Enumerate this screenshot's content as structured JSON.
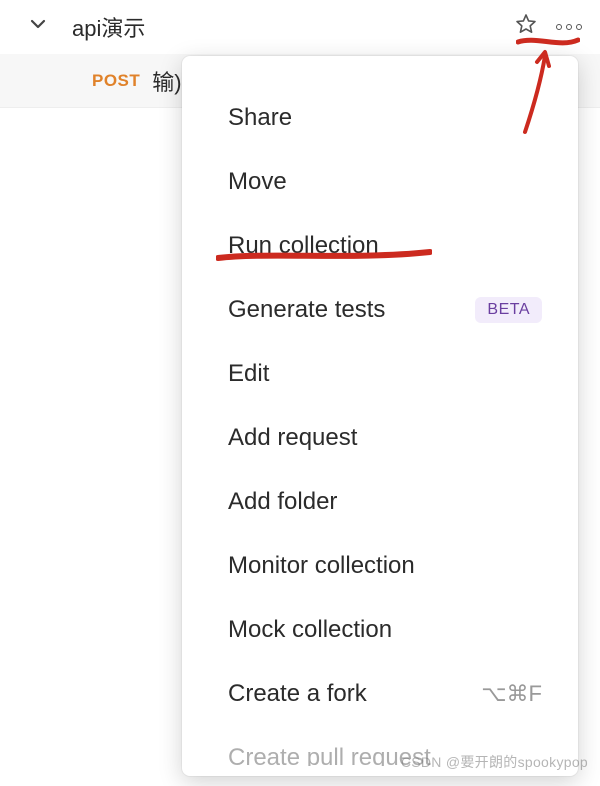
{
  "header": {
    "title": "api演示"
  },
  "request": {
    "method": "POST",
    "name": "输)"
  },
  "menu": {
    "share": {
      "label": "Share"
    },
    "move": {
      "label": "Move"
    },
    "run_collection": {
      "label": "Run collection"
    },
    "generate_tests": {
      "label": "Generate tests",
      "badge": "BETA"
    },
    "edit": {
      "label": "Edit"
    },
    "add_request": {
      "label": "Add request"
    },
    "add_folder": {
      "label": "Add folder"
    },
    "monitor_collection": {
      "label": "Monitor collection"
    },
    "mock_collection": {
      "label": "Mock collection"
    },
    "create_fork": {
      "label": "Create a fork",
      "shortcut": "⌥⌘F"
    },
    "create_pull_request": {
      "label": "Create pull request"
    }
  },
  "watermark": "CSDN @要开朗的spookypop",
  "annotations": {
    "color": "#cc2a1f"
  }
}
